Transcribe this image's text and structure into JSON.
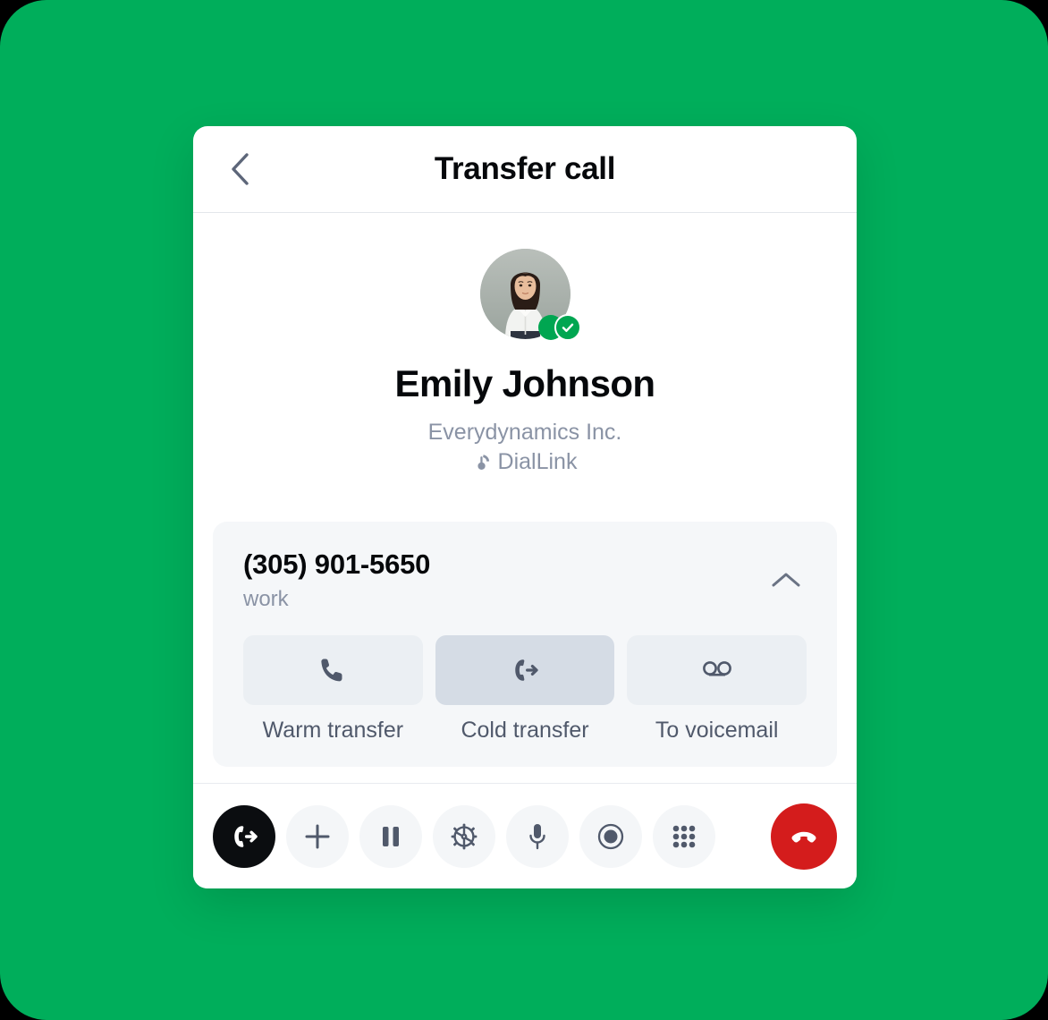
{
  "theme": {
    "background": "#00AE5B",
    "card_background": "#FFFFFF",
    "accent_green": "#00A651",
    "hangup_red": "#D41C1C",
    "muted_text": "#8A93A5",
    "icon_color": "#50596B"
  },
  "header": {
    "back_icon": "chevron-left-icon",
    "title": "Transfer call"
  },
  "contact": {
    "name": "Emily Johnson",
    "company": "Everydynamics Inc.",
    "source": "DialLink",
    "source_icon": "diallink-logo-icon",
    "avatar_alt": "Emily Johnson avatar",
    "status_icon": "online-verified-icon"
  },
  "number_card": {
    "number": "(305) 901-5650",
    "label": "work",
    "collapse_icon": "chevron-up-icon",
    "options": [
      {
        "id": "warm",
        "label": "Warm transfer",
        "icon": "phone-icon",
        "selected": false
      },
      {
        "id": "cold",
        "label": "Cold transfer",
        "icon": "phone-forward-icon",
        "selected": true
      },
      {
        "id": "voicemail",
        "label": "To voicemail",
        "icon": "voicemail-icon",
        "selected": false
      }
    ]
  },
  "toolbar": {
    "buttons": [
      {
        "id": "transfer",
        "icon": "phone-forward-icon",
        "label": "Transfer",
        "active": true
      },
      {
        "id": "add",
        "icon": "plus-icon",
        "label": "Add call",
        "active": false
      },
      {
        "id": "hold",
        "icon": "pause-icon",
        "label": "Hold",
        "active": false
      },
      {
        "id": "settings",
        "icon": "gear-icon",
        "label": "Settings",
        "active": false
      },
      {
        "id": "mute",
        "icon": "microphone-icon",
        "label": "Mute",
        "active": false
      },
      {
        "id": "record",
        "icon": "record-icon",
        "label": "Record",
        "active": false
      },
      {
        "id": "keypad",
        "icon": "dialpad-icon",
        "label": "Keypad",
        "active": false
      }
    ],
    "hangup": {
      "id": "hangup",
      "icon": "hangup-icon",
      "label": "End call"
    }
  }
}
